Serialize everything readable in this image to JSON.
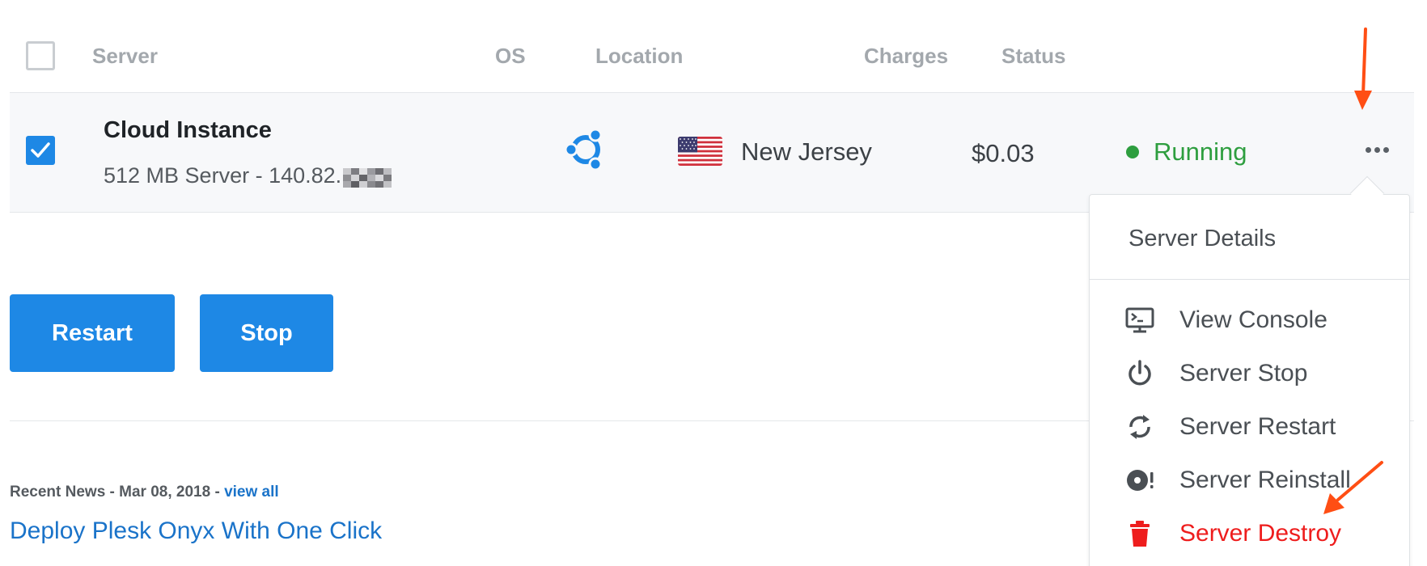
{
  "table": {
    "headers": [
      "Server",
      "OS",
      "Location",
      "Charges",
      "Status"
    ]
  },
  "server": {
    "name": "Cloud Instance",
    "description": "512 MB Server - 140.82.",
    "os_icon": "ubuntu-icon",
    "location_flag": "us-flag-icon",
    "location": "New Jersey",
    "charges": "$0.03",
    "status": "Running",
    "status_color": "#2e9e3f",
    "selected": true
  },
  "actions": {
    "restart_label": "Restart",
    "stop_label": "Stop"
  },
  "news": {
    "meta_prefix": "Recent News - Mar 08, 2018 - ",
    "view_all": "view all",
    "headline": "Deploy Plesk Onyx With One Click"
  },
  "menu": {
    "details_label": "Server Details",
    "items": [
      {
        "label": "View Console",
        "icon": "console-icon"
      },
      {
        "label": "Server Stop",
        "icon": "power-icon"
      },
      {
        "label": "Server Restart",
        "icon": "refresh-icon"
      },
      {
        "label": "Server Reinstall",
        "icon": "disc-icon"
      },
      {
        "label": "Server Destroy",
        "icon": "trash-icon"
      }
    ],
    "danger_color": "#ee1d1d"
  },
  "colors": {
    "primary": "#1e88e5",
    "link": "#1a73c9",
    "annotation_arrow": "#ff4e14"
  }
}
